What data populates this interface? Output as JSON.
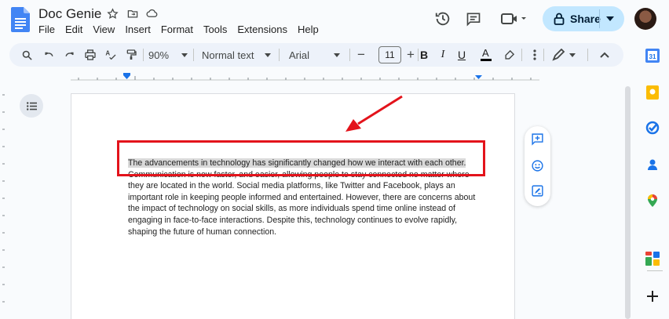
{
  "app": {
    "doc_title": "Doc Genie",
    "menu": [
      "File",
      "Edit",
      "View",
      "Insert",
      "Format",
      "Tools",
      "Extensions",
      "Help"
    ],
    "share_label": "Share"
  },
  "toolbar": {
    "zoom": "90%",
    "style": "Normal text",
    "font": "Arial",
    "font_size": "11"
  },
  "document": {
    "highlighted_sentence": "The advancements in technology has significantly changed how we interact with each other.",
    "rest_text": "Communication is now faster, and easier, allowing people to stay connected no matter where they are located in the world. Social media platforms, like Twitter and Facebook, plays an important role in keeping people informed and entertained. However, there are concerns about the impact of technology on social skills, as more individuals spend time online instead of engaging in face-to-face interactions. Despite this, technology continues to evolve rapidly, shaping the future of human connection."
  },
  "colors": {
    "accent": "#1a73e8",
    "share_bg": "#c2e7ff",
    "annotation_red": "#e3131b",
    "highlight": "#d9d9d9"
  },
  "side_panel_icons": [
    "calendar-icon",
    "keep-icon",
    "tasks-icon",
    "contacts-icon",
    "maps-icon",
    "apps-icon",
    "add-icon"
  ]
}
